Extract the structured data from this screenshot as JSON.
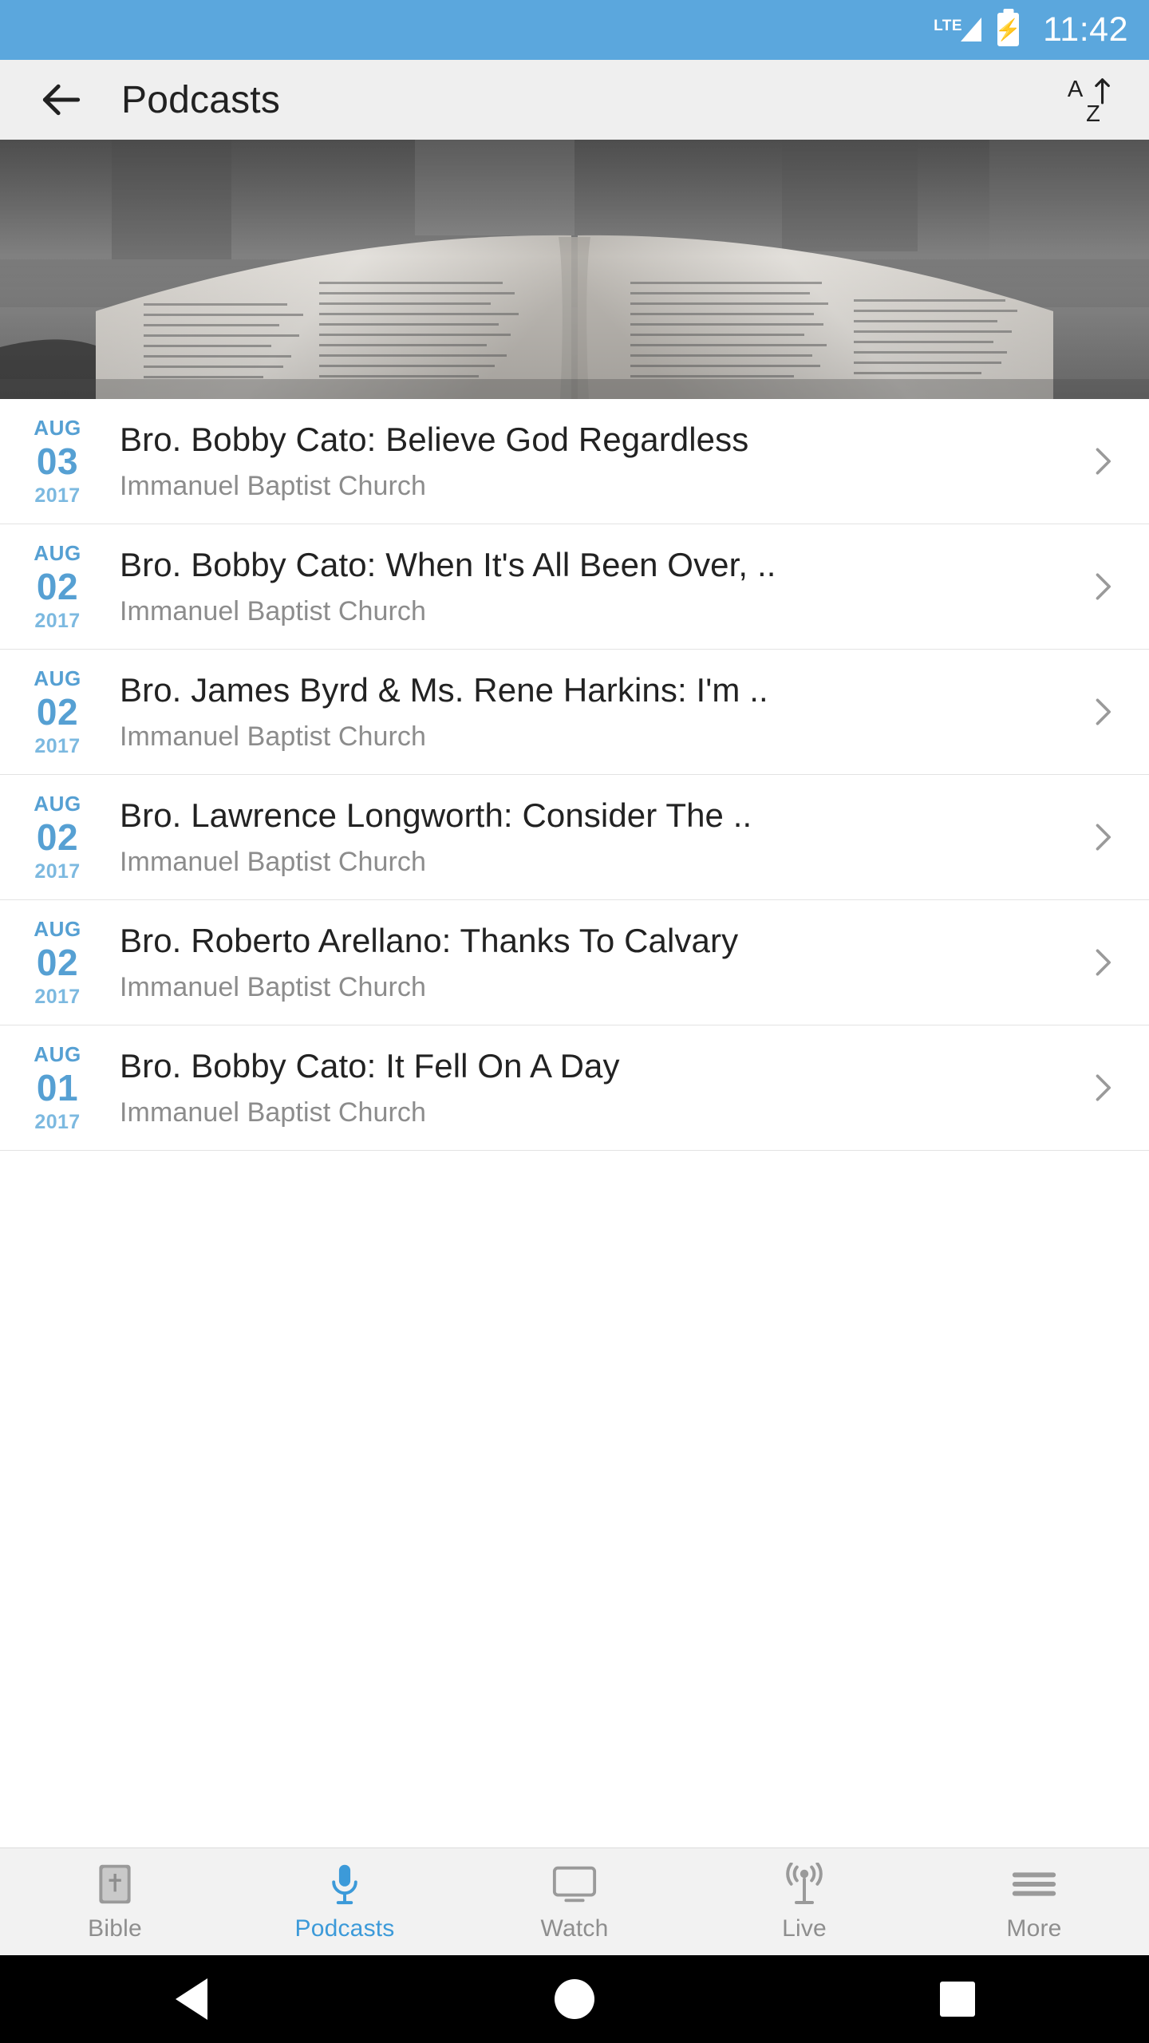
{
  "status_bar": {
    "network_label": "LTE",
    "signal_icon": "signal-triangle-icon",
    "battery_icon": "battery-charging-icon",
    "time": "11:42",
    "background_color": "#5ba7dd"
  },
  "app_bar": {
    "back_icon": "back-arrow-icon",
    "title": "Podcasts",
    "sort_icon": "sort-az-icon",
    "background_color": "#efefef"
  },
  "hero": {
    "image_description": "open-bible-photo",
    "alt": "Open Bible on stand"
  },
  "episodes": [
    {
      "month": "AUG",
      "day": "03",
      "year": "2017",
      "title": "Bro. Bobby Cato: Believe God Regardless",
      "subtitle": "Immanuel Baptist Church",
      "chevron": "chevron-right-icon"
    },
    {
      "month": "AUG",
      "day": "02",
      "year": "2017",
      "title": "Bro. Bobby Cato: When It's All Been Over, ..",
      "subtitle": "Immanuel Baptist Church",
      "chevron": "chevron-right-icon"
    },
    {
      "month": "AUG",
      "day": "02",
      "year": "2017",
      "title": "Bro. James Byrd & Ms. Rene Harkins: I'm ..",
      "subtitle": "Immanuel Baptist Church",
      "chevron": "chevron-right-icon"
    },
    {
      "month": "AUG",
      "day": "02",
      "year": "2017",
      "title": "Bro. Lawrence Longworth: Consider The ..",
      "subtitle": "Immanuel Baptist Church",
      "chevron": "chevron-right-icon"
    },
    {
      "month": "AUG",
      "day": "02",
      "year": "2017",
      "title": "Bro. Roberto Arellano: Thanks To Calvary",
      "subtitle": "Immanuel Baptist Church",
      "chevron": "chevron-right-icon"
    },
    {
      "month": "AUG",
      "day": "01",
      "year": "2017",
      "title": "Bro. Bobby Cato: It Fell On A Day",
      "subtitle": "Immanuel Baptist Church",
      "chevron": "chevron-right-icon"
    }
  ],
  "tab_bar": {
    "active_color": "#3c9ad9",
    "inactive_color": "#8e8e8e",
    "tabs": [
      {
        "label": "Bible",
        "icon": "bible-book-icon",
        "active": false
      },
      {
        "label": "Podcasts",
        "icon": "microphone-icon",
        "active": true
      },
      {
        "label": "Watch",
        "icon": "monitor-icon",
        "active": false
      },
      {
        "label": "Live",
        "icon": "broadcast-tower-icon",
        "active": false
      },
      {
        "label": "More",
        "icon": "hamburger-menu-icon",
        "active": false
      }
    ]
  },
  "nav_bar": {
    "back": "android-back-icon",
    "home": "android-home-icon",
    "recents": "android-recents-icon"
  }
}
